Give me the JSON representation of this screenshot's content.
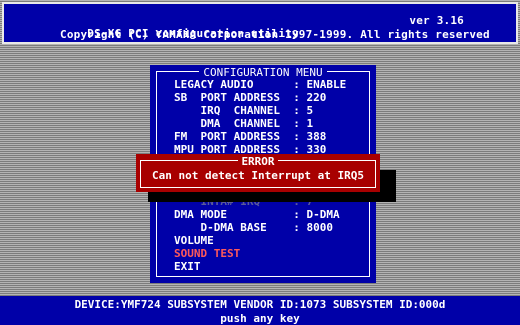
{
  "header": {
    "title": "DS-XG PCI configuration utility",
    "version": "ver 3.16",
    "copyright": "Copyright (C) YAMAHA Corporation 1997-1999. All rights reserved"
  },
  "menu": {
    "title": "CONFIGURATION MENU",
    "rows": [
      "LEGACY AUDIO      : ENABLE",
      "SB  PORT ADDRESS  : 220",
      "    IRQ  CHANNEL  : 5",
      "    DMA  CHANNEL  : 1",
      "FM  PORT ADDRESS  : 388",
      "MPU PORT ADDRESS  : 330",
      "    INTA# IRQ     : 7",
      "DMA MODE          : D-DMA",
      "    D-DMA BASE    : 8000",
      "VOLUME",
      "SOUND TEST",
      "EXIT"
    ]
  },
  "error": {
    "title": "ERROR",
    "message": "Can not detect Interrupt at IRQ5"
  },
  "footer": {
    "device_line": "DEVICE:YMF724  SUBSYSTEM VENDOR ID:1073  SUBSYSTEM ID:000d",
    "prompt": "push any key"
  },
  "colors": {
    "panel_blue": "#0000a8",
    "error_red": "#a80000",
    "highlight_text": "#ff5a5a"
  }
}
